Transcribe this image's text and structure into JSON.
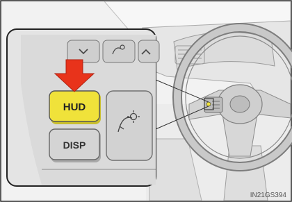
{
  "buttons": {
    "hud_label": "HUD",
    "disp_label": "DISP"
  },
  "reference_code": "IN21GS394",
  "highlight": {
    "hud_button_color": "#f0e23a",
    "arrow_color": "#e8331b"
  },
  "icons": {
    "arrow": "down-arrow-icon",
    "top_buttons": [
      "chevron-down-icon",
      "camera-settings-icon",
      "chevron-up-icon"
    ],
    "side_button": "camera-settings-icon"
  }
}
